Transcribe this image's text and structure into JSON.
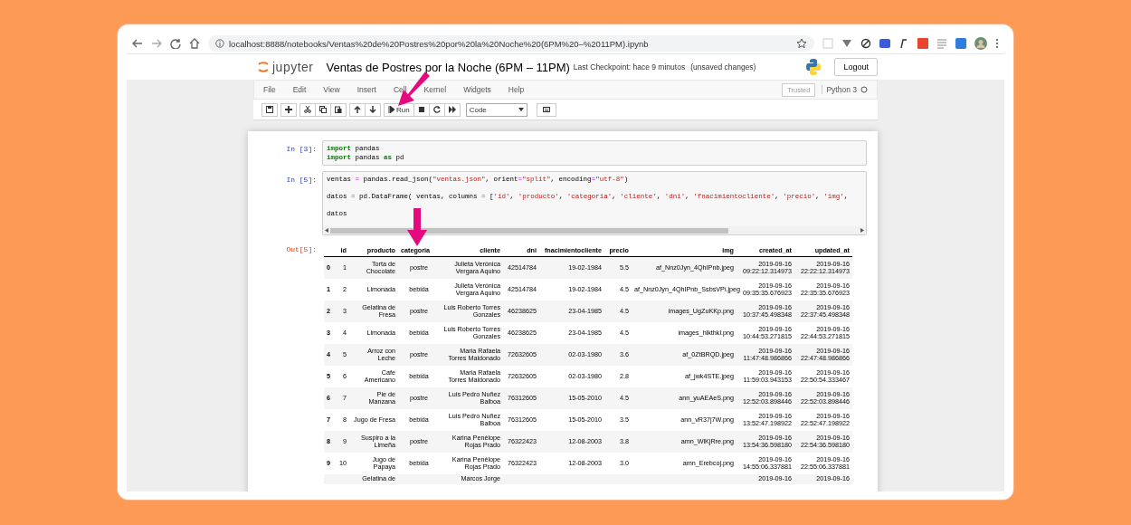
{
  "browser": {
    "url": "localhost:8888/notebooks/Ventas%20de%20Postres%20por%20la%20Noche%20(6PM%20–%2011PM).ipynb"
  },
  "header": {
    "logo_text": "jupyter",
    "title": "Ventas de Postres por la Noche (6PM – 11PM)",
    "checkpoint": "Last Checkpoint: hace 9 minutos",
    "save_status": "(unsaved changes)",
    "logout": "Logout"
  },
  "menu": [
    "File",
    "Edit",
    "View",
    "Insert",
    "Cell",
    "Kernel",
    "Widgets",
    "Help"
  ],
  "trusted": "Trusted",
  "kernel": "Python 3",
  "toolbar": {
    "run": "Run",
    "cell_type": "Code"
  },
  "cells": [
    {
      "prompt": "In [3]:",
      "spaced_lines": false,
      "horizontal_scrollbar": false,
      "lines": [
        [
          {
            "kind": "keyword",
            "text": "import"
          },
          {
            "text": " pandas"
          }
        ],
        [
          {
            "kind": "keyword",
            "text": "import"
          },
          {
            "text": " pandas "
          },
          {
            "kind": "keyword",
            "text": "as"
          },
          {
            "text": " pd"
          }
        ]
      ]
    },
    {
      "prompt": "In [5]:",
      "spaced_lines": true,
      "horizontal_scrollbar": true,
      "lines": [
        [
          {
            "text": "ventas "
          },
          {
            "kind": "operator",
            "text": "="
          },
          {
            "text": " pandas.read_json("
          },
          {
            "kind": "string",
            "text": "\"ventas.json\""
          },
          {
            "text": ", orient"
          },
          {
            "kind": "operator",
            "text": "="
          },
          {
            "kind": "string",
            "text": "\"split\""
          },
          {
            "text": ", encoding"
          },
          {
            "kind": "operator",
            "text": "="
          },
          {
            "kind": "string",
            "text": "\"utf-8\""
          },
          {
            "text": ")"
          }
        ],
        [
          {
            "text": "datos "
          },
          {
            "kind": "operator",
            "text": "="
          },
          {
            "text": " pd.DataFrame( ventas, columns "
          },
          {
            "kind": "operator",
            "text": "="
          },
          {
            "text": " ["
          },
          {
            "kind": "string",
            "text": "'id'"
          },
          {
            "text": ", "
          },
          {
            "kind": "string",
            "text": "'producto'"
          },
          {
            "text": ", "
          },
          {
            "kind": "string",
            "text": "'categoria'"
          },
          {
            "text": ", "
          },
          {
            "kind": "string",
            "text": "'cliente'"
          },
          {
            "text": ", "
          },
          {
            "kind": "string",
            "text": "'dni'"
          },
          {
            "text": ", "
          },
          {
            "kind": "string",
            "text": "'fnacimientocliente'"
          },
          {
            "text": ", "
          },
          {
            "kind": "string",
            "text": "'precio'"
          },
          {
            "text": ", "
          },
          {
            "kind": "string",
            "text": "'img'"
          },
          {
            "text": ","
          }
        ],
        [
          {
            "text": "datos"
          }
        ]
      ]
    }
  ],
  "output": {
    "prompt": "Out[5]:",
    "table": {
      "columns": [
        "id",
        "producto",
        "categoria",
        "cliente",
        "dni",
        "fnacimientocliente",
        "precio",
        "img",
        "created_at",
        "updated_at"
      ],
      "rows": [
        {
          "index": "0",
          "cells": [
            "1",
            "Torta de Chocolate",
            "postre",
            "Julieta Verónica Vergara Aquino",
            "42514784",
            "19-02-1984",
            "5.5",
            "af_Nnz0Jyn_4QhIPnb.jpeg",
            "2019-09-16 09:22:12.314973",
            "2019-09-16 22:22:12.314973"
          ]
        },
        {
          "index": "1",
          "cells": [
            "2",
            "Limonada",
            "bebida",
            "Julieta Verónica Vergara Aquino",
            "42514784",
            "19-02-1984",
            "4.5",
            "af_Nnz0Jyn_4QhIPnb_SsbsVPi.jpeg",
            "2019-09-16 09:35:35.676923",
            "2019-09-16 22:35:35.676923"
          ]
        },
        {
          "index": "2",
          "cells": [
            "3",
            "Gelatina de Fresa",
            "postre",
            "Luis Roberto Torres Gonzales",
            "46238625",
            "23-04-1985",
            "4.5",
            "images_UgZuKKp.png",
            "2019-09-16 10:37:45.498348",
            "2019-09-16 22:37:45.498348"
          ]
        },
        {
          "index": "3",
          "cells": [
            "4",
            "Limonada",
            "bebida",
            "Luis Roberto Torres Gonzales",
            "46238625",
            "23-04-1985",
            "4.5",
            "images_hlkthkl.png",
            "2019-09-16 10:44:53.271815",
            "2019-09-16 22:44:53.271815"
          ]
        },
        {
          "index": "4",
          "cells": [
            "5",
            "Arroz con Leche",
            "postre",
            "Maria Rafaela Torres Maldonado",
            "72632605",
            "02-03-1980",
            "3.6",
            "af_0ZtBRQD.jpeg",
            "2019-09-16 11:47:48.986866",
            "2019-09-16 22:47:48.986866"
          ]
        },
        {
          "index": "5",
          "cells": [
            "6",
            "Cafe Americano",
            "bebida",
            "Maria Rafaela Torres Maldonado",
            "72632605",
            "02-03-1980",
            "2.8",
            "af_jwk4STE.jpeg",
            "2019-09-16 11:59:03.943153",
            "2019-09-16 22:50:54.333467"
          ]
        },
        {
          "index": "6",
          "cells": [
            "7",
            "Pie de Manzana",
            "postre",
            "Luis Pedro Nuñez Balboa",
            "76312605",
            "15-05-2010",
            "4.5",
            "ann_yuAEAeS.png",
            "2019-09-16 12:52:03.898446",
            "2019-09-16 22:52:03.898446"
          ]
        },
        {
          "index": "7",
          "cells": [
            "8",
            "Jugo de Fresa",
            "bebida",
            "Luis Pedro Nuñez Balboa",
            "76312605",
            "15-05-2010",
            "3.5",
            "ann_vR37j7W.png",
            "2019-09-16 13:52:47.198922",
            "2019-09-16 22:52:47.198922"
          ]
        },
        {
          "index": "8",
          "cells": [
            "9",
            "Suspiro a la Limeña",
            "postre",
            "Karina Penélope Rojas Prado",
            "76322423",
            "12-08-2003",
            "3.8",
            "amn_WlKjRre.png",
            "2019-09-16 13:54:36.598180",
            "2019-09-16 22:54:36.598180"
          ]
        },
        {
          "index": "9",
          "cells": [
            "10",
            "Jugo de Papaya",
            "bebida",
            "Karina Penélope Rojas Prado",
            "76322423",
            "12-08-2003",
            "3.0",
            "amn_Erebcoj.png",
            "2019-09-16 14:55:06.337881",
            "2019-09-16 22:55:06.337881"
          ]
        },
        {
          "cells": [
            null,
            "Gelatina de",
            null,
            "Marcos Jorge",
            null,
            null,
            null,
            null,
            "2019-09-16",
            "2019-09-16"
          ]
        }
      ]
    }
  }
}
